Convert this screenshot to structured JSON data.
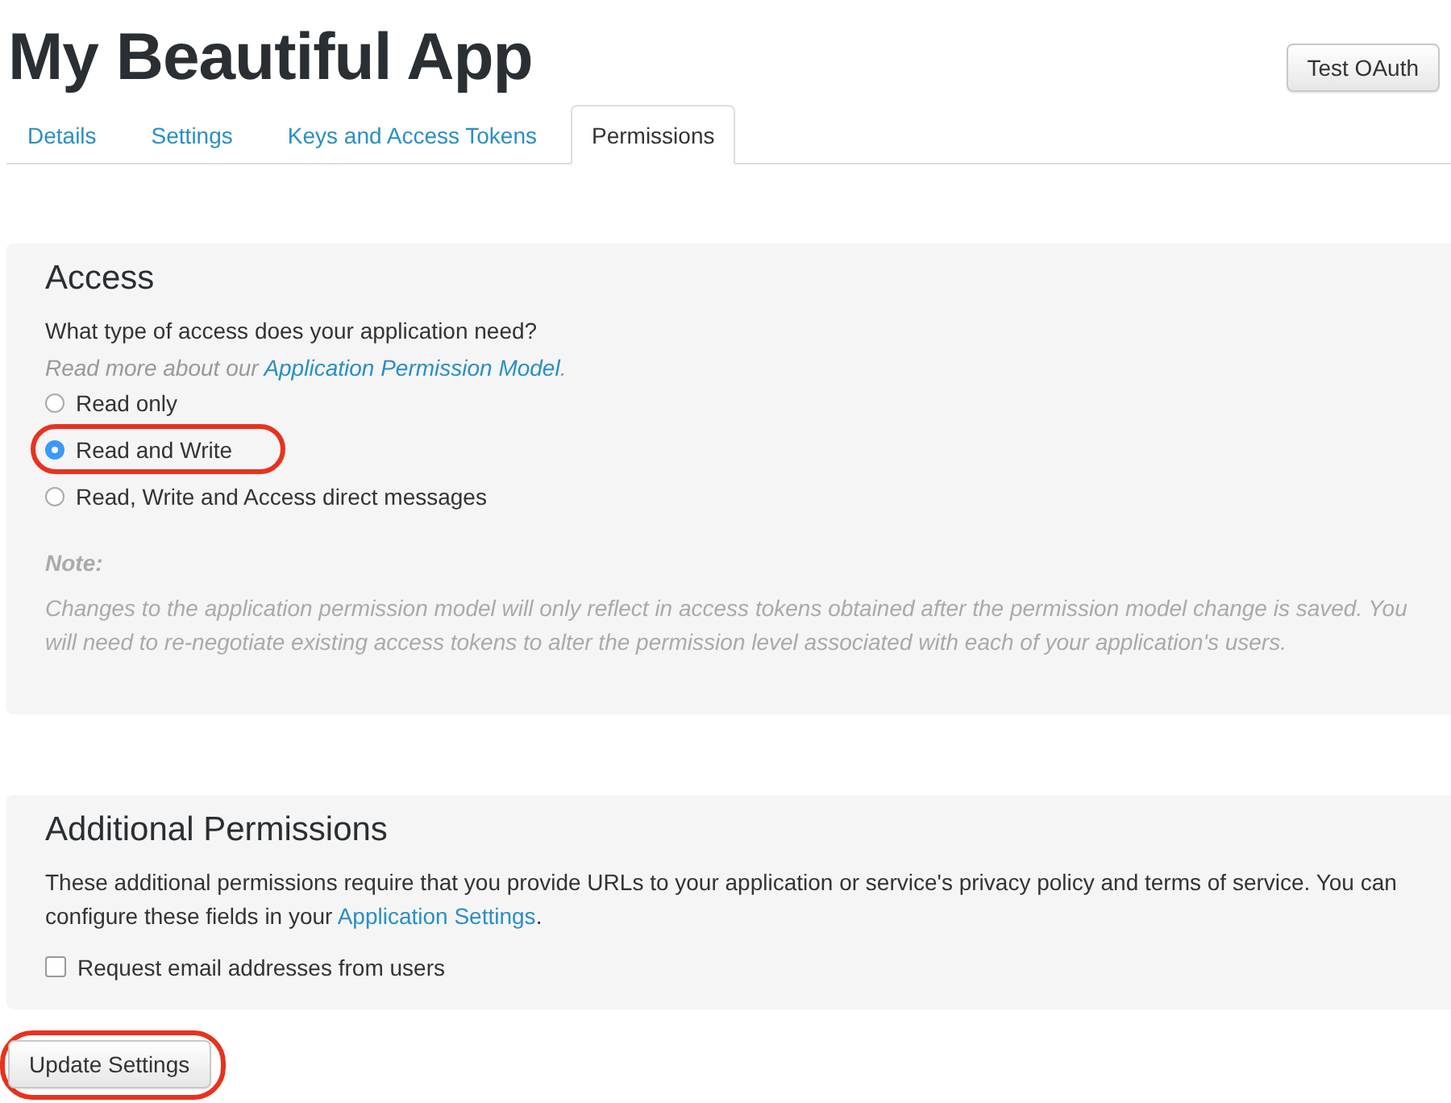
{
  "app_title": "My Beautiful App",
  "header_button": {
    "label": "Test OAuth"
  },
  "tabs": [
    {
      "label": "Details",
      "selected": false
    },
    {
      "label": "Settings",
      "selected": false
    },
    {
      "label": "Keys and Access Tokens",
      "selected": false
    },
    {
      "label": "Permissions",
      "selected": true
    }
  ],
  "access": {
    "heading": "Access",
    "question": "What type of access does your application need?",
    "hint": {
      "before": "Read more about our ",
      "link": "Application Permission Model",
      "after": "."
    },
    "options": [
      {
        "label": "Read only",
        "selected": false,
        "highlighted": false
      },
      {
        "label": "Read and Write",
        "selected": true,
        "highlighted": true
      },
      {
        "label": "Read, Write and Access direct messages",
        "selected": false,
        "highlighted": false
      }
    ],
    "note_label": "Note:",
    "note": "Changes to the application permission model will only reflect in access tokens obtained after the permission model change is saved. You will need to re-negotiate existing access tokens to alter the permission level associated with each of your application's users."
  },
  "additional": {
    "heading": "Additional Permissions",
    "text": {
      "before": "These additional permissions require that you provide URLs to your application or service's privacy policy and terms of service. You can configure these fields in your ",
      "link": "Application Settings",
      "after": "."
    },
    "checkbox": {
      "label": "Request email addresses from users",
      "checked": false
    }
  },
  "submit": {
    "label": "Update Settings",
    "highlighted": true
  }
}
